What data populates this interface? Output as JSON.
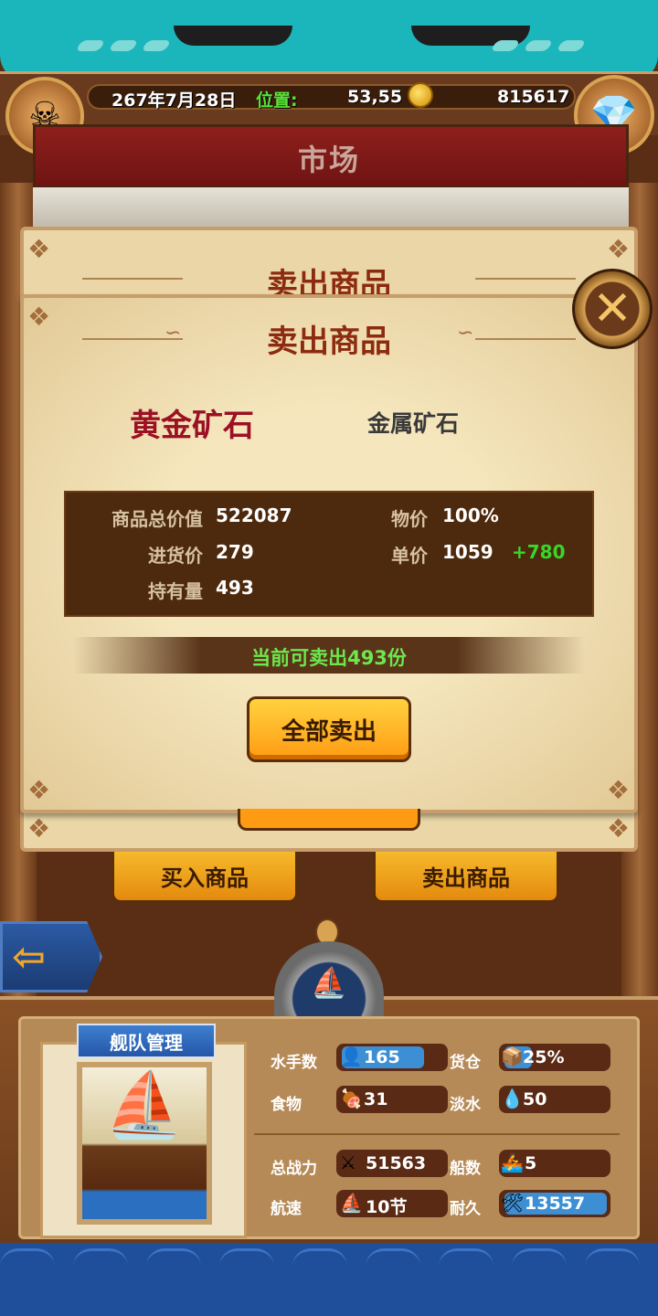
{
  "header": {
    "date": "267年7月28日",
    "position_label": "位置:",
    "position": "53,55",
    "gold": "815617",
    "avatar_icon": "pirate-avatar-icon",
    "chest_icon": "treasure-chest-icon"
  },
  "market": {
    "title": "市场"
  },
  "back_dialog": {
    "title": "卖出商品"
  },
  "sell_dialog": {
    "title": "卖出商品",
    "goods_name": "黄金矿石",
    "goods_type": "金属矿石",
    "stats": {
      "total_value_label": "商品总价值",
      "total_value": "522087",
      "price_index_label": "物价",
      "price_index": "100%",
      "purchase_price_label": "进货价",
      "purchase_price": "279",
      "unit_price_label": "单价",
      "unit_price": "1059",
      "profit": "+780",
      "holding_label": "持有量",
      "holding": "493"
    },
    "sellable": "当前可卖出493份",
    "sell_all": "全部卖出"
  },
  "trade": {
    "buy_label": "买入商品",
    "sell_label": "卖出商品"
  },
  "fleet": {
    "label": "舰队管理",
    "sailors_label": "水手数",
    "sailors": "165",
    "cargo_label": "货仓",
    "cargo": "25%",
    "food_label": "食物",
    "food": "31",
    "water_label": "淡水",
    "water": "50",
    "power_label": "总战力",
    "power": "51563",
    "ships_label": "船数",
    "ships": "5",
    "speed_label": "航速",
    "speed": "10节",
    "durability_label": "耐久",
    "durability": "13557"
  },
  "colors": {
    "profit": "#39d62a",
    "sellable": "#6ce84d",
    "goods_name": "#9b1023",
    "dialog_title": "#8c2b10"
  }
}
